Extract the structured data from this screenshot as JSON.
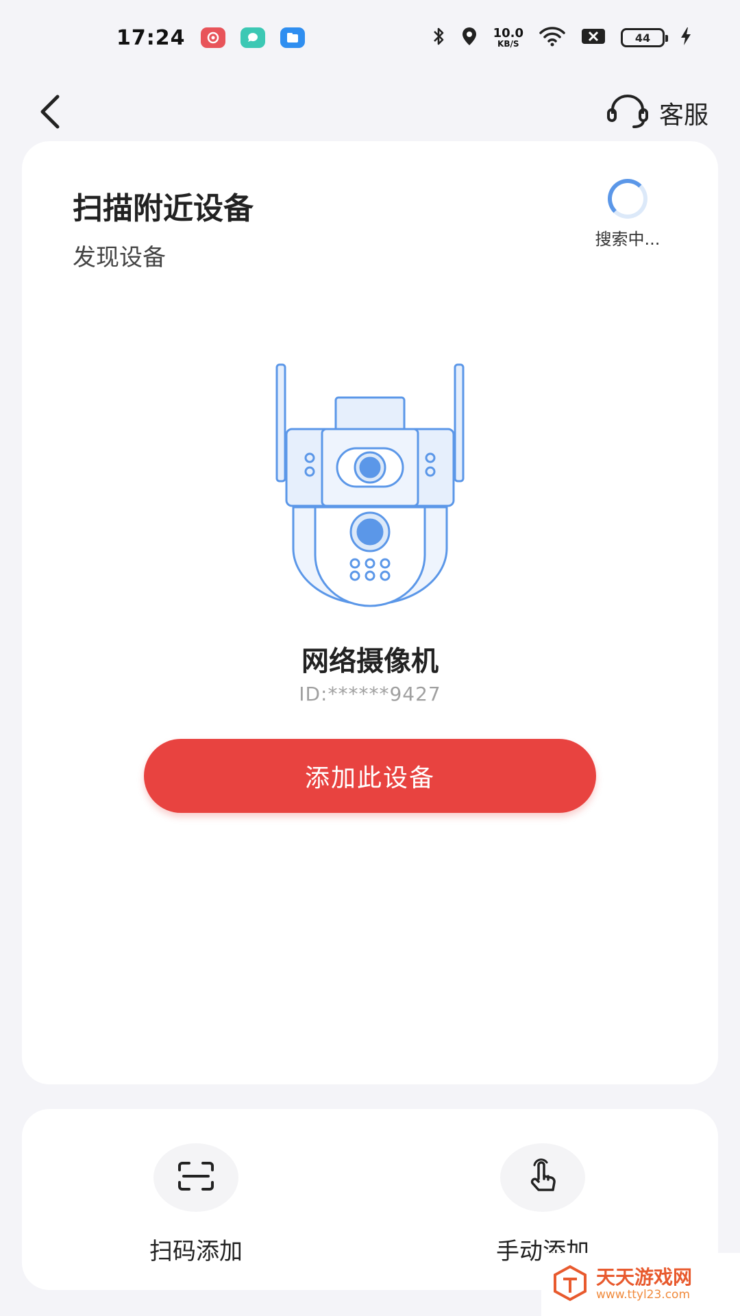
{
  "status_bar": {
    "time": "17:24",
    "net_speed_value": "10.0",
    "net_speed_unit": "KB/S",
    "battery": "44",
    "icons": [
      "red-app-icon",
      "teal-chat-app-icon",
      "blue-folder-app-icon",
      "bluetooth-icon",
      "location-icon",
      "wifi-icon",
      "sim-off-icon",
      "charging-icon"
    ]
  },
  "header": {
    "back_icon": "back-arrow-icon",
    "support_icon": "headset-icon",
    "support_label": "客服"
  },
  "scan": {
    "title": "扫描附近设备",
    "subtitle": "发现设备",
    "status_label": "搜索中..."
  },
  "device": {
    "name": "网络摄像机",
    "id": "ID:******9427",
    "add_button_label": "添加此设备",
    "illustration": "dual-lens-camera-icon"
  },
  "add_options": [
    {
      "label": "扫码添加",
      "icon": "scan-frame-icon"
    },
    {
      "label": "手动添加",
      "icon": "hand-tap-icon"
    }
  ],
  "watermark": {
    "title": "天天游戏网",
    "url": "www.ttyl23.com"
  },
  "colors": {
    "accent_red": "#e84340",
    "illustration_blue": "#5b97e8",
    "background": "#f4f4f8"
  }
}
